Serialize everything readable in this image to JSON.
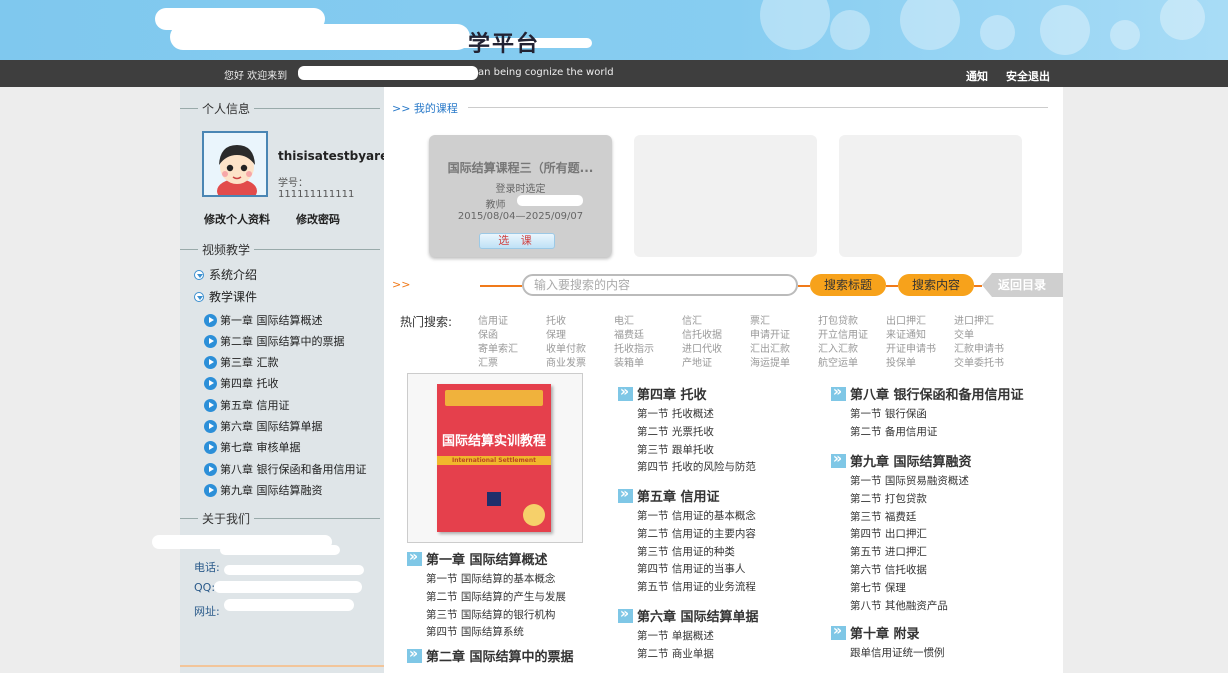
{
  "header": {
    "site_title": "学平台",
    "greeting": "您好  欢迎来到",
    "slogan": "an being cognize the world",
    "links": [
      "通知",
      "安全退出"
    ]
  },
  "sidebar": {
    "personal_title": "个人信息",
    "username": "thisisatestbyaredhac",
    "student_no": "学号：111111111111",
    "edit_profile": "修改个人资料",
    "change_password": "修改密码",
    "video_title": "视频教学",
    "tree": [
      {
        "label": "系统介绍"
      },
      {
        "label": "教学课件"
      }
    ],
    "chapters": [
      "第一章 国际结算概述",
      "第二章 国际结算中的票据",
      "第三章 汇款",
      "第四章 托收",
      "第五章 信用证",
      "第六章 国际结算单据",
      "第七章 审核单据",
      "第八章 银行保函和备用信用证",
      "第九章 国际结算融资"
    ],
    "about_title": "关于我们",
    "contacts": [
      "电话:",
      "QQ:",
      "网址:"
    ]
  },
  "main": {
    "breadcrumb": ">> 我的课程",
    "course": {
      "title": "国际结算课程三（所有题...",
      "line1": "登录时选定",
      "line2": "教师",
      "dates": "2015/08/04—2025/09/07",
      "button": "选 课"
    },
    "search": {
      "prefix": ">>",
      "placeholder": "输入要搜索的内容",
      "btn_title": "搜索标题",
      "btn_content": "搜索内容",
      "btn_back": "返回目录"
    },
    "hot_label": "热门搜索:",
    "hot_columns": [
      [
        "信用证",
        "保函",
        "寄单索汇",
        "汇票"
      ],
      [
        "托收",
        "保理",
        "收单付款",
        "商业发票"
      ],
      [
        "电汇",
        "福费廷",
        "托收指示",
        "装箱单"
      ],
      [
        "信汇",
        "信托收据",
        "进口代收",
        "产地证"
      ],
      [
        "票汇",
        "申请开证",
        "汇出汇款",
        "海运提单"
      ],
      [
        "打包贷款",
        "开立信用证",
        "汇入汇款",
        "航空运单"
      ],
      [
        "出口押汇",
        "来证通知",
        "开证申请书",
        "投保单"
      ],
      [
        "进口押汇",
        "交单",
        "汇款申请书",
        "交单委托书"
      ]
    ],
    "book": {
      "cover_title": "国际结算实训教程",
      "cover_band": "International Settlement"
    },
    "toc": [
      {
        "title": "第一章  国际结算概述",
        "sections": [
          "第一节 国际结算的基本概念",
          "第二节 国际结算的产生与发展",
          "第三节 国际结算的银行机构",
          "第四节 国际结算系统"
        ]
      },
      {
        "title": "第二章  国际结算中的票据",
        "sections": []
      },
      {
        "title": "第四章  托收",
        "sections": [
          "第一节 托收概述",
          "第二节 光票托收",
          "第三节 跟单托收",
          "第四节 托收的风险与防范"
        ]
      },
      {
        "title": "第五章  信用证",
        "sections": [
          "第一节 信用证的基本概念",
          "第二节 信用证的主要内容",
          "第三节 信用证的种类",
          "第四节 信用证的当事人",
          "第五节 信用证的业务流程"
        ]
      },
      {
        "title": "第六章  国际结算单据",
        "sections": [
          "第一节 单据概述",
          "第二节 商业单据"
        ]
      },
      {
        "title": "第八章  银行保函和备用信用证",
        "sections": [
          "第一节 银行保函",
          "第二节 备用信用证"
        ]
      },
      {
        "title": "第九章  国际结算融资",
        "sections": [
          "第一节 国际贸易融资概述",
          "第二节 打包贷款",
          "第三节 福费廷",
          "第四节 出口押汇",
          "第五节 进口押汇",
          "第六节 信托收据",
          "第七节 保理",
          "第八节 其他融资产品"
        ]
      },
      {
        "title": "第十章  附录",
        "sections": [
          "跟单信用证统一惯例"
        ]
      }
    ]
  }
}
